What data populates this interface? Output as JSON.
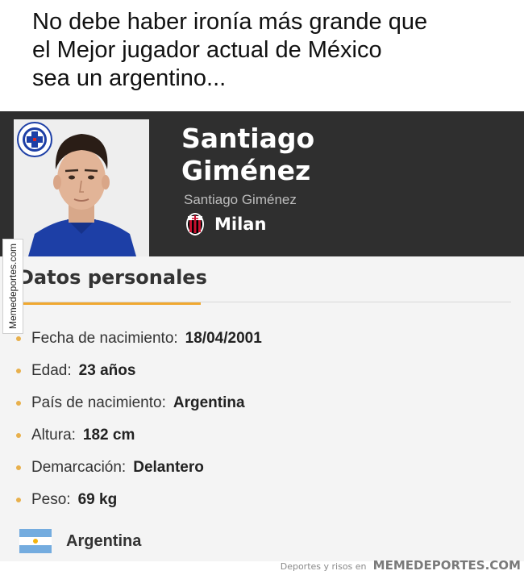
{
  "caption": {
    "lines": [
      "No debe haber ironía más grande que",
      "el Mejor jugador actual de México",
      "sea un argentino..."
    ]
  },
  "profile": {
    "name_lines": [
      "Santiago",
      "Giménez"
    ],
    "full_name": "Santiago Giménez",
    "club": "Milan",
    "club_icon": "milan-crest-icon",
    "photo_badge_icon": "cruz-azul-crest-icon"
  },
  "section": {
    "title": "Datos personales",
    "accent_color": "#f0a830"
  },
  "facts": [
    {
      "label": "Fecha de nacimiento:",
      "value": "18/04/2001"
    },
    {
      "label": "Edad:",
      "value": "23 años"
    },
    {
      "label": "País de nacimiento:",
      "value": "Argentina"
    },
    {
      "label": "Altura:",
      "value": "182 cm"
    },
    {
      "label": "Demarcación:",
      "value": "Delantero"
    },
    {
      "label": "Peso:",
      "value": "69 kg"
    }
  ],
  "nationality": {
    "label": "Argentina",
    "flag_icon": "argentina-flag-icon"
  },
  "watermark": {
    "side": "Memedeportes.com",
    "footer_small": "Deportes y risos en",
    "footer_brand": "MEMEDEPORTES.COM"
  }
}
